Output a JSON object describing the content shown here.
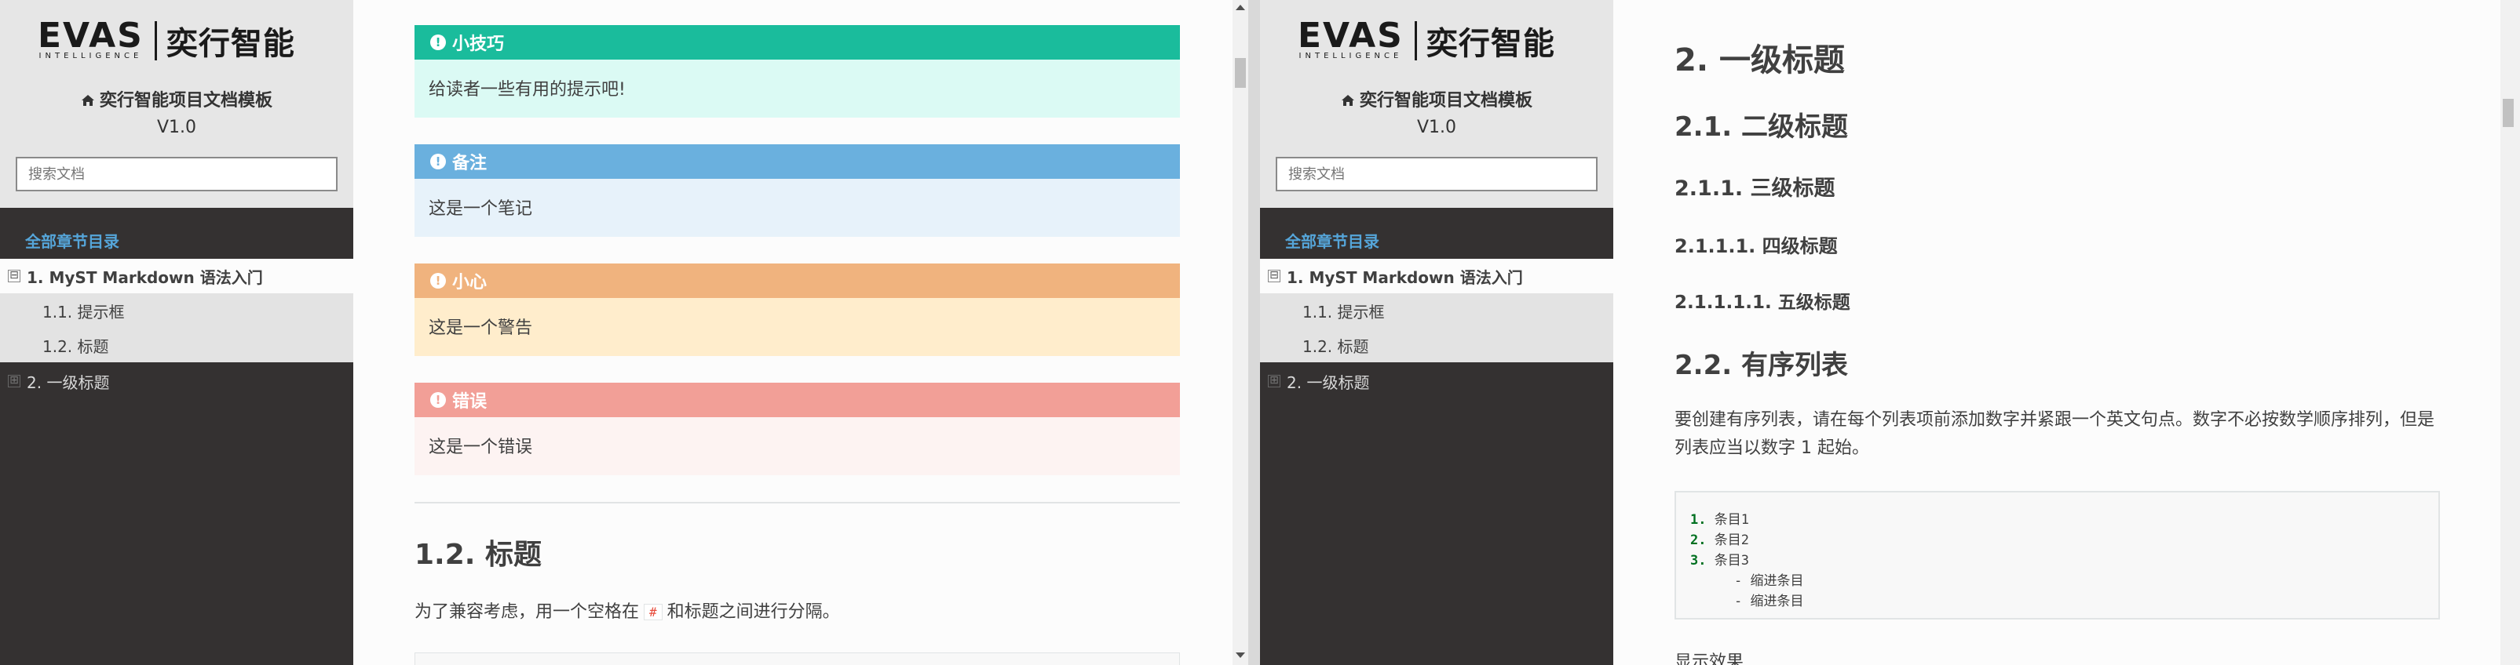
{
  "left_pane": {
    "sidebar": {
      "logo": {
        "word": "EVAS",
        "sub": "INTELLIGENCE",
        "cn": "奕行智能"
      },
      "project_title": "奕行智能项目文档模板",
      "version": "V1.0",
      "search_placeholder": "搜索文档",
      "nav_caption": "全部章节目录",
      "items": [
        {
          "label": "1. MyST Markdown 语法入门",
          "toggle": "⊟"
        },
        {
          "label": "1.1. 提示框"
        },
        {
          "label": "1.2. 标题"
        },
        {
          "label": "2. 一级标题",
          "toggle": "⊞"
        }
      ]
    },
    "admonitions": [
      {
        "title": "小技巧",
        "body": "给读者一些有用的提示吧!"
      },
      {
        "title": "备注",
        "body": "这是一个笔记"
      },
      {
        "title": "小心",
        "body": "这是一个警告"
      },
      {
        "title": "错误",
        "body": "这是一个错误"
      }
    ],
    "section_heading": "1.2. 标题",
    "paragraph_before": "为了兼容考虑，用一个空格在",
    "paragraph_code": "#",
    "paragraph_after": "和标题之间进行分隔。"
  },
  "right_pane": {
    "sidebar": {
      "logo": {
        "word": "EVAS",
        "sub": "INTELLIGENCE",
        "cn": "奕行智能"
      },
      "project_title": "奕行智能项目文档模板",
      "version": "V1.0",
      "search_placeholder": "搜索文档",
      "nav_caption": "全部章节目录",
      "items": [
        {
          "label": "1. MyST Markdown 语法入门",
          "toggle": "⊟"
        },
        {
          "label": "1.1. 提示框"
        },
        {
          "label": "1.2. 标题"
        },
        {
          "label": "2. 一级标题",
          "toggle": "⊞"
        }
      ]
    },
    "headings": {
      "h1": "2. 一级标题",
      "h2": "2.1. 二级标题",
      "h3": "2.1.1. 三级标题",
      "h4": "2.1.1.1. 四级标题",
      "h5": "2.1.1.1.1. 五级标题",
      "h2b": "2.2. 有序列表"
    },
    "paragraph": "要创建有序列表，请在每个列表项前添加数字并紧跟一个英文句点。数字不必按数学顺序排列，但是列表应当以数字 1 起始。",
    "code": {
      "items": [
        {
          "num": "1.",
          "text": "条目1"
        },
        {
          "num": "2.",
          "text": "条目2"
        },
        {
          "num": "3.",
          "text": "条目3"
        }
      ],
      "subitems": [
        "缩进条目",
        "缩进条目"
      ]
    },
    "display_label": "显示效果"
  },
  "colors": {
    "tip": {
      "header": "#1abc9c",
      "body": "#dbfaf4"
    },
    "note": {
      "header": "#6ab0de",
      "body": "#e7f2fa"
    },
    "caution": {
      "header": "#f0b37e",
      "body": "#ffedcc"
    },
    "error": {
      "header": "#f29f97",
      "body": "#fdf3f2"
    }
  }
}
